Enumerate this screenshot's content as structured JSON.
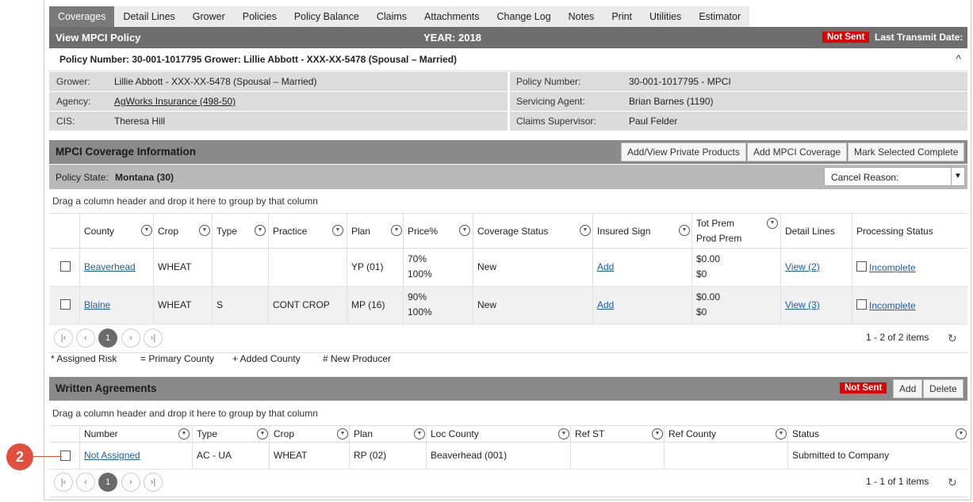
{
  "tabs": [
    "Coverages",
    "Detail Lines",
    "Grower",
    "Policies",
    "Policy Balance",
    "Claims",
    "Attachments",
    "Change Log",
    "Notes",
    "Print",
    "Utilities",
    "Estimator"
  ],
  "title": {
    "left": "View MPCI Policy",
    "year": "YEAR: 2018",
    "status_badge": "Not Sent",
    "transmit": "Last Transmit Date:"
  },
  "policy_header": {
    "text": "Policy Number: 30-001-1017795 Grower: Lillie Abbott - XXX-XX-5478 (Spousal – Married)",
    "caret": "^"
  },
  "info": {
    "grower_label": "Grower:",
    "grower": "Lillie Abbott - XXX-XX-5478 (Spousal – Married)",
    "agency_label": "Agency:",
    "agency": "AgWorks Insurance (498-50)",
    "cis_label": "CIS:",
    "cis": "Theresa Hill",
    "policy_label": "Policy Number:",
    "policy": "30-001-1017795 - MPCI",
    "agent_label": "Servicing Agent:",
    "agent": "Brian Barnes (1190)",
    "supervisor_label": "Claims Supervisor:",
    "supervisor": "Paul Felder"
  },
  "coverage": {
    "title": "MPCI Coverage Information",
    "buttons": [
      "Add/View Private Products",
      "Add MPCI Coverage",
      "Mark Selected Complete"
    ],
    "state_label": "Policy State:",
    "state": "Montana (30)",
    "cancel_reason": "Cancel Reason:",
    "drag_hint": "Drag a column header and drop it here to group by that column",
    "columns": [
      "County",
      "Crop",
      "Type",
      "Practice",
      "Plan",
      "Price%",
      "Coverage Status",
      "Insured Sign",
      "Tot Prem",
      "Prod Prem",
      "Detail Lines",
      "Processing Status"
    ],
    "rows": [
      {
        "county": "Beaverhead",
        "crop": "WHEAT",
        "type": "",
        "practice": "",
        "plan": "YP (01)",
        "price1": "70%",
        "price2": "100%",
        "status": "New",
        "sign": "Add",
        "prem1": "$0.00",
        "prem2": "$0",
        "detail": "View (2)",
        "processing": "Incomplete"
      },
      {
        "county": "Blaine",
        "crop": "WHEAT",
        "type": "S",
        "practice": "CONT CROP",
        "plan": "MP (16)",
        "price1": "90%",
        "price2": "100%",
        "status": "New",
        "sign": "Add",
        "prem1": "$0.00",
        "prem2": "$0",
        "detail": "View (3)",
        "processing": "Incomplete"
      }
    ],
    "pager": {
      "page": "1",
      "items": "1 - 2 of 2 items"
    },
    "legend": [
      "* Assigned Risk",
      "= Primary County",
      "+ Added County",
      "# New Producer"
    ]
  },
  "agreements": {
    "title": "Written Agreements",
    "status_badge": "Not Sent",
    "buttons": [
      "Add",
      "Delete"
    ],
    "drag_hint": "Drag a column header and drop it here to group by that column",
    "columns": [
      "Number",
      "Type",
      "Crop",
      "Plan",
      "Loc County",
      "Ref ST",
      "Ref County",
      "Status"
    ],
    "rows": [
      {
        "number": "Not Assigned",
        "type": "AC - UA",
        "crop": "WHEAT",
        "plan": "RP (02)",
        "loc_county": "Beaverhead (001)",
        "ref_st": "",
        "ref_county": "",
        "status": "Submitted to Company"
      }
    ],
    "pager": {
      "page": "1",
      "items": "1 - 1 of 1 items"
    }
  },
  "callout": "2",
  "icons": {
    "filter": "filter-icon",
    "first": "first-page-icon",
    "prev": "prev-page-icon",
    "next": "next-page-icon",
    "last": "last-page-icon",
    "refresh": "refresh-icon",
    "collapse": "chevron-up-icon"
  }
}
